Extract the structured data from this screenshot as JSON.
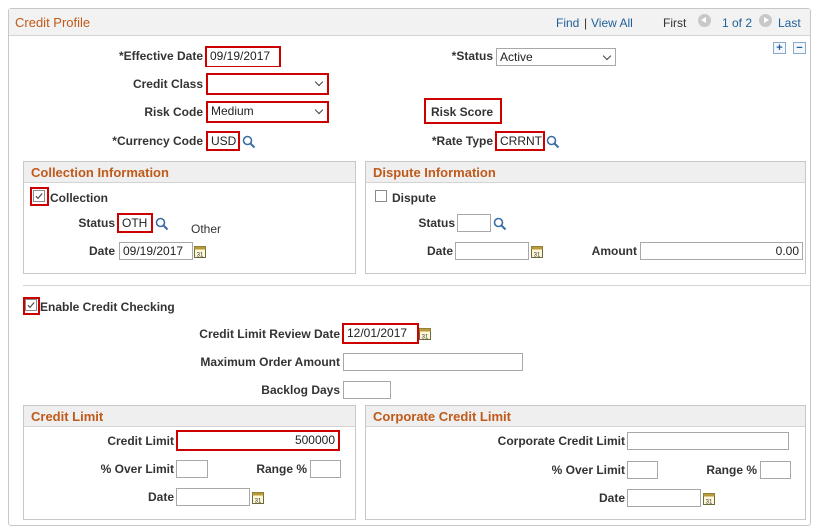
{
  "header": {
    "title": "Credit Profile",
    "find": "Find",
    "separator": "|",
    "view_all": "View All",
    "first": "First",
    "page": "1 of 2",
    "last": "Last"
  },
  "controls": {
    "add": "+",
    "remove": "−"
  },
  "profile": {
    "effective_date_label": "*Effective Date",
    "effective_date": "09/19/2017",
    "status_label": "*Status",
    "status": "Active",
    "credit_class_label": "Credit Class",
    "credit_class": "",
    "risk_code_label": "Risk Code",
    "risk_code": "Medium",
    "risk_score_label": "Risk Score",
    "currency_code_label": "*Currency Code",
    "currency_code": "USD",
    "rate_type_label": "*Rate Type",
    "rate_type": "CRRNT"
  },
  "collection": {
    "title": "Collection Information",
    "checkbox_label": "Collection",
    "checked": true,
    "status_label": "Status",
    "status": "OTH",
    "status_desc": "Other",
    "date_label": "Date",
    "date": "09/19/2017"
  },
  "dispute": {
    "title": "Dispute Information",
    "checkbox_label": "Dispute",
    "checked": false,
    "status_label": "Status",
    "status": "",
    "date_label": "Date",
    "date": "",
    "amount_label": "Amount",
    "amount": "0.00"
  },
  "credit_checking": {
    "label": "Enable Credit Checking",
    "checked": true,
    "review_date_label": "Credit Limit Review Date",
    "review_date": "12/01/2017",
    "max_order_label": "Maximum Order Amount",
    "max_order": "",
    "backlog_label": "Backlog Days",
    "backlog": ""
  },
  "credit_limit": {
    "title": "Credit Limit",
    "limit_label": "Credit Limit",
    "limit": "500000",
    "over_label": "% Over Limit",
    "over": "",
    "range_label": "Range %",
    "range": "",
    "date_label": "Date",
    "date": ""
  },
  "corporate_limit": {
    "title": "Corporate Credit Limit",
    "limit_label": "Corporate Credit Limit",
    "limit": "",
    "over_label": "% Over Limit",
    "over": "",
    "range_label": "Range %",
    "range": "",
    "date_label": "Date",
    "date": ""
  },
  "colors": {
    "title_orange": "#c05a1a",
    "link_blue": "#1f5e99",
    "highlight_red": "#cc0000"
  }
}
